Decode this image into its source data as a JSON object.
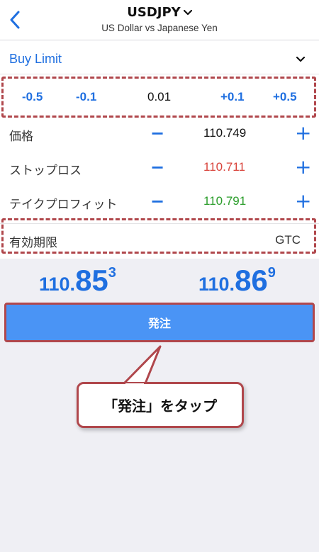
{
  "header": {
    "symbol": "USDJPY",
    "subtitle": "US Dollar vs Japanese Yen"
  },
  "order_type": {
    "label": "Buy Limit"
  },
  "steps": [
    "-0.5",
    "-0.1",
    "0.01",
    "+0.1",
    "+0.5"
  ],
  "price_row": {
    "label": "価格",
    "minus": "−",
    "value": "110.749",
    "plus": "+"
  },
  "stop_loss_row": {
    "label": "ストップロス",
    "minus": "−",
    "value": "110.711",
    "plus": "+"
  },
  "take_profit_row": {
    "label": "テイクプロフィット",
    "minus": "−",
    "value": "110.791",
    "plus": "+"
  },
  "expiry": {
    "label": "有効期限",
    "value": "GTC"
  },
  "bid": {
    "prefix": "110.",
    "big": "85",
    "sup": "3"
  },
  "ask": {
    "prefix": "110.",
    "big": "86",
    "sup": "9"
  },
  "order_button": {
    "label": "発注"
  },
  "callout": {
    "text": "「発注」をタップ"
  },
  "colors": {
    "accent": "#1f6fe0",
    "stop_loss": "#d9453d",
    "take_profit": "#2a9d2a",
    "annotation": "#b0474c",
    "button": "#4a94f5"
  }
}
